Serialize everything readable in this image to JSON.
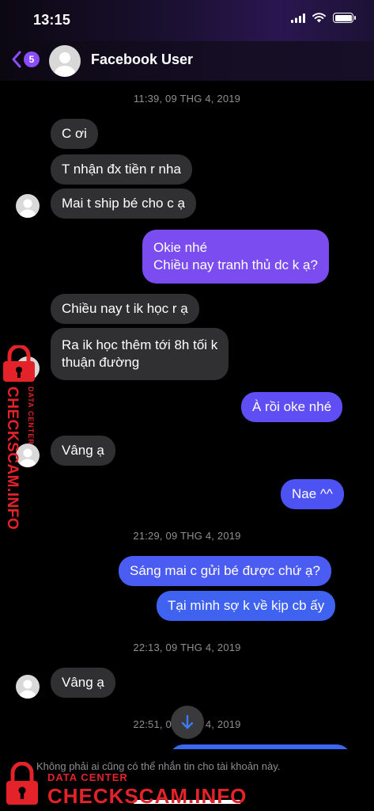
{
  "status_bar": {
    "time": "13:15"
  },
  "header": {
    "back_badge": "5",
    "contact_name": "Facebook User"
  },
  "colors": {
    "accent": "#8a4dfd",
    "incoming_bubble": "#303033",
    "watermark": "#e3222a"
  },
  "timestamps": [
    "11:39, 09 THG 4, 2019",
    "21:29, 09 THG 4, 2019",
    "22:13, 09 THG 4, 2019",
    "22:51, 09 THG 4, 2019"
  ],
  "messages": [
    {
      "dir": "in",
      "text": "C ơi"
    },
    {
      "dir": "in",
      "text": "T nhận đx tiền r nha"
    },
    {
      "dir": "in",
      "text": "Mai t ship bé cho c ạ"
    },
    {
      "dir": "out",
      "lines": [
        "Okie nhé",
        "Chiều nay tranh thủ dc k ạ?"
      ]
    },
    {
      "dir": "in",
      "text": "Chiều nay t ik học r ạ"
    },
    {
      "dir": "in",
      "lines": [
        "Ra ik học thêm tới 8h tối k",
        "thuận đường"
      ]
    },
    {
      "dir": "out",
      "text": "À rồi oke nhé"
    },
    {
      "dir": "in",
      "text": "Vâng ạ"
    },
    {
      "dir": "out",
      "text": "Nae ^^"
    },
    {
      "dir": "out",
      "text": "Sáng mai c gửi bé được chứ ạ?"
    },
    {
      "dir": "out",
      "text": "Tại mình sợ k về kịp cb ấy"
    },
    {
      "dir": "in",
      "text": "Vâng ạ"
    }
  ],
  "footer": {
    "notice": "Không phải ai cũng có thể nhắn tin cho tài khoản này."
  },
  "icons": [
    "back-chevron-icon",
    "signal-icon",
    "wifi-icon",
    "battery-icon",
    "arrow-down-icon",
    "padlock-logo-icon"
  ],
  "watermark": {
    "sub": "DATA CENTER",
    "main": "CHECKSCAM.INFO"
  }
}
